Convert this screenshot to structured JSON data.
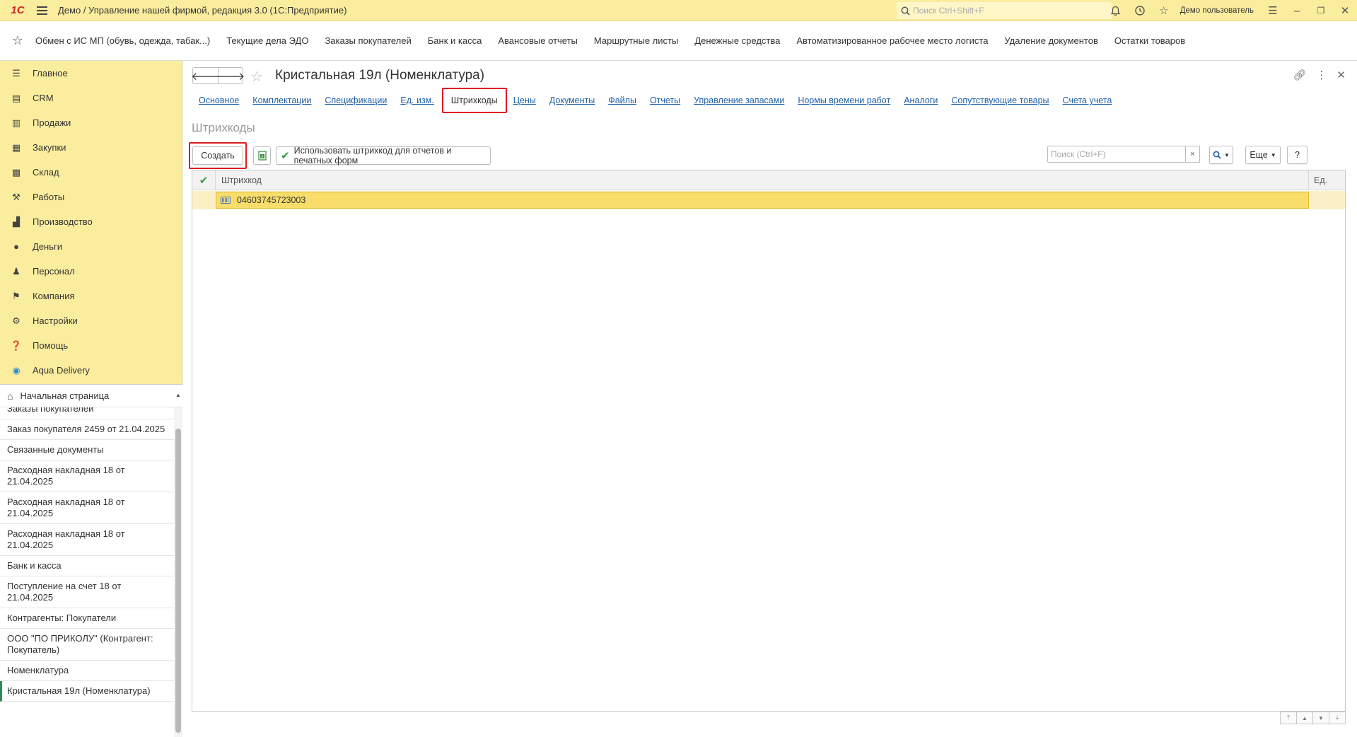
{
  "titlebar": {
    "logo": "1С",
    "title": "Демо / Управление нашей фирмой, редакция 3.0  (1С:Предприятие)",
    "search_placeholder": "Поиск Ctrl+Shift+F",
    "user": "Демо пользователь"
  },
  "favorites": [
    "Обмен с ИС МП (обувь, одежда, табак...)",
    "Текущие дела ЭДО",
    "Заказы покупателей",
    "Банк и касса",
    "Авансовые отчеты",
    "Маршрутные листы",
    "Денежные средства",
    "Автоматизированное рабочее место логиста",
    "Удаление документов",
    "Остатки товаров"
  ],
  "sidebar": {
    "items": [
      {
        "label": "Главное",
        "icon": "menu-icon"
      },
      {
        "label": "CRM",
        "icon": "crm-icon"
      },
      {
        "label": "Продажи",
        "icon": "cart-icon"
      },
      {
        "label": "Закупки",
        "icon": "purchase-icon"
      },
      {
        "label": "Склад",
        "icon": "warehouse-icon"
      },
      {
        "label": "Работы",
        "icon": "tools-icon"
      },
      {
        "label": "Производство",
        "icon": "factory-icon"
      },
      {
        "label": "Деньги",
        "icon": "ruble-icon"
      },
      {
        "label": "Персонал",
        "icon": "people-icon"
      },
      {
        "label": "Компания",
        "icon": "flag-icon"
      },
      {
        "label": "Настройки",
        "icon": "gear-icon"
      },
      {
        "label": "Помощь",
        "icon": "help-icon"
      },
      {
        "label": "Aqua Delivery",
        "icon": "location-icon"
      }
    ],
    "home": "Начальная страница",
    "history": [
      "Заказы покупателей",
      "Заказ покупателя 2459 от 21.04.2025",
      "Связанные документы",
      "Расходная накладная 18 от 21.04.2025",
      "Расходная накладная 18 от 21.04.2025",
      "Расходная накладная 18 от 21.04.2025",
      "Банк и касса",
      "Поступление на счет 18 от 21.04.2025",
      "Контрагенты: Покупатели",
      "ООО \"ПО ПРИКОЛУ\" (Контрагент: Покупатель)",
      "Номенклатура",
      "Кристальная 19л (Номенклатура)"
    ]
  },
  "form": {
    "title": "Кристальная 19л (Номенклатура)",
    "tabs": [
      "Основное",
      "Комплектации",
      "Спецификации",
      "Ед. изм.",
      "Штрихкоды",
      "Цены",
      "Документы",
      "Файлы",
      "Отчеты",
      "Управление запасами",
      "Нормы времени работ",
      "Аналоги",
      "Сопутствующие товары",
      "Счета учета"
    ],
    "active_tab": "Штрихкоды",
    "section_title": "Штрихкоды",
    "buttons": {
      "create": "Создать",
      "use_barcode": "Использовать штрихкод для отчетов и печатных форм",
      "search_placeholder": "Поиск (Ctrl+F)",
      "clear": "×",
      "more": "Еще",
      "help": "?"
    },
    "table": {
      "columns": {
        "barcode": "Штрихкод",
        "unit": "Ед."
      },
      "rows": [
        {
          "barcode": "04603745723003",
          "unit": ""
        }
      ]
    }
  },
  "colors": {
    "accent_yellow": "#fbed9e",
    "highlight_red": "#e01b22",
    "link_blue": "#1e5fa8",
    "check_green": "#2e9e3e"
  }
}
